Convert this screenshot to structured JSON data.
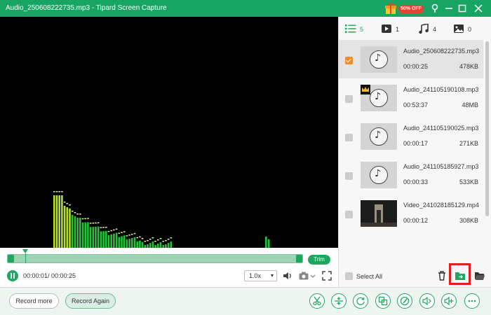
{
  "window": {
    "title": "Audio_250608222735.mp3  -  Tipard Screen Capture",
    "promo_badge": "50% OFF"
  },
  "player": {
    "time_display": "00:00:01/ 00:00:25",
    "speed": "1.0x",
    "trim_label": "Trim",
    "progress_fraction": 0.04
  },
  "bottom": {
    "record_more": "Record more",
    "record_again": "Record Again",
    "tools": [
      "scissors-icon",
      "split-icon",
      "rotate-icon",
      "merge-icon",
      "edit-icon",
      "volume-adjust-icon",
      "volume-boost-icon",
      "more-icon"
    ]
  },
  "sidebar": {
    "tabs": [
      {
        "icon": "list-icon",
        "count": "5"
      },
      {
        "icon": "video-icon",
        "count": "1"
      },
      {
        "icon": "audio-icon",
        "count": "4"
      },
      {
        "icon": "image-icon",
        "count": "0"
      }
    ],
    "items": [
      {
        "name": "Audio_250608222735.mp3",
        "duration": "00:00:25",
        "size": "478KB",
        "selected": true,
        "type": "audio"
      },
      {
        "name": "Audio_241105190108.mp3",
        "duration": "00:53:37",
        "size": "48MB",
        "selected": false,
        "type": "audio",
        "crown": true
      },
      {
        "name": "Audio_241105190025.mp3",
        "duration": "00:00:17",
        "size": "271KB",
        "selected": false,
        "type": "audio"
      },
      {
        "name": "Audio_241105185927.mp3",
        "duration": "00:00:33",
        "size": "533KB",
        "selected": false,
        "type": "audio"
      },
      {
        "name": "Video_241028185129.mp4",
        "duration": "00:00:12",
        "size": "308KB",
        "selected": false,
        "type": "video"
      }
    ],
    "select_all": "Select All"
  },
  "colors": {
    "accent": "#1ea85f",
    "titlebar": "#17a561",
    "highlight": "#e0201e"
  }
}
